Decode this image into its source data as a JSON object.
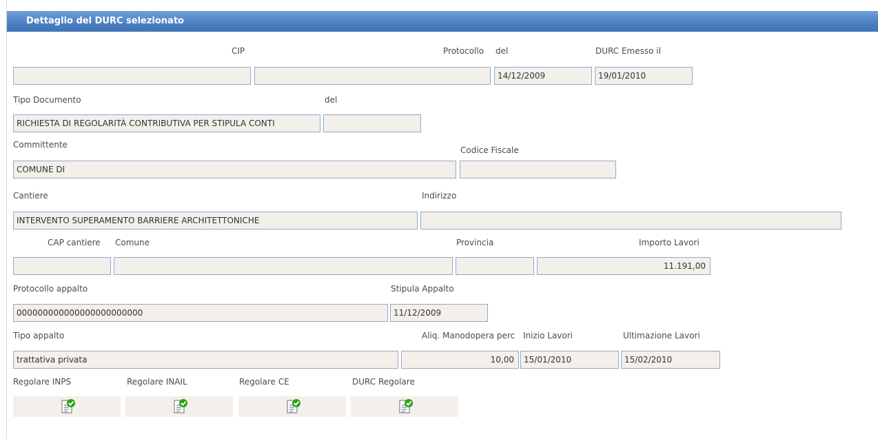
{
  "panel": {
    "title": "Dettaglio del DURC selezionato"
  },
  "row1": {
    "cip_label": "CIP",
    "protocollo_label": "Protocollo",
    "del_label": "del",
    "emesso_label": "DURC Emesso il",
    "cip_value": "",
    "protocollo_value": "",
    "del_value": "14/12/2009",
    "emesso_value": "19/01/2010"
  },
  "row2": {
    "tipo_label": "Tipo Documento",
    "del_label": "del",
    "tipo_value": "RICHIESTA DI REGOLARITÀ CONTRIBUTIVA PER STIPULA CONTI",
    "del_value": ""
  },
  "row3": {
    "committente_label": "Committente",
    "cf_label": "Codice Fiscale",
    "committente_value": "COMUNE DI",
    "cf_value": ""
  },
  "row4": {
    "cantiere_label": "Cantiere",
    "indirizzo_label": "Indirizzo",
    "cantiere_value": "INTERVENTO SUPERAMENTO BARRIERE ARCHITETTONICHE",
    "indirizzo_value": ""
  },
  "row5": {
    "cap_label": "CAP cantiere",
    "comune_label": "Comune",
    "provincia_label": "Provincia",
    "importo_label": "Importo Lavori",
    "cap_value": "",
    "comune_value": "",
    "provincia_value": "",
    "importo_value": "11.191,00"
  },
  "row6": {
    "protappalto_label": "Protocollo appalto",
    "stipula_label": "Stipula Appalto",
    "protappalto_value": "000000000000000000000000",
    "stipula_value": "11/12/2009"
  },
  "row7": {
    "tipoappalto_label": "Tipo appalto",
    "aliq_label": "Aliq. Manodopera perc",
    "inizio_label": "Inizio Lavori",
    "fine_label": "Ultimazione Lavori",
    "tipoappalto_value": "trattativa privata",
    "aliq_value": "10,00",
    "inizio_value": "15/01/2010",
    "fine_value": "15/02/2010"
  },
  "row8": {
    "inps_label": "Regolare INPS",
    "inail_label": "Regolare INAIL",
    "ce_label": "Regolare CE",
    "durc_label": "DURC Regolare",
    "icon": "document-check-icon",
    "check_color": "#2aa01e"
  }
}
